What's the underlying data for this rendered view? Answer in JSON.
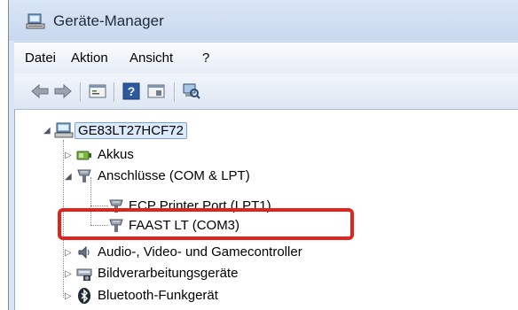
{
  "window": {
    "title": "Geräte-Manager",
    "title_icon": "device-manager-icon"
  },
  "menu": {
    "items": [
      "Datei",
      "Aktion",
      "Ansicht",
      "?"
    ]
  },
  "toolbar": {
    "buttons": [
      {
        "icon": "back-arrow-icon"
      },
      {
        "icon": "forward-arrow-icon"
      },
      {
        "icon": "properties-icon"
      },
      {
        "icon": "help-icon"
      },
      {
        "icon": "view-icon"
      },
      {
        "icon": "scan-hardware-icon"
      }
    ]
  },
  "tree": {
    "root": {
      "label": "GE83LT27HCF72",
      "icon": "computer-icon",
      "expanded": true
    },
    "items": [
      {
        "label": "Akkus",
        "icon": "battery-icon",
        "expanded": false
      },
      {
        "label": "Anschlüsse (COM & LPT)",
        "icon": "port-icon",
        "expanded": true,
        "children": [
          {
            "label": "ECP Printer Port (LPT1)",
            "icon": "port-icon"
          },
          {
            "label": "FAAST LT (COM3)",
            "icon": "port-icon",
            "highlighted": true
          }
        ]
      },
      {
        "label": "Audio-, Video- und Gamecontroller",
        "icon": "audio-icon",
        "expanded": false
      },
      {
        "label": "Bildverarbeitungsgeräte",
        "icon": "imaging-device-icon",
        "expanded": false
      },
      {
        "label": "Bluetooth-Funkgerät",
        "icon": "bluetooth-icon",
        "expanded": false
      }
    ]
  },
  "colors": {
    "highlight_border": "#e2231a",
    "selection_bg": "#dbeafc"
  }
}
